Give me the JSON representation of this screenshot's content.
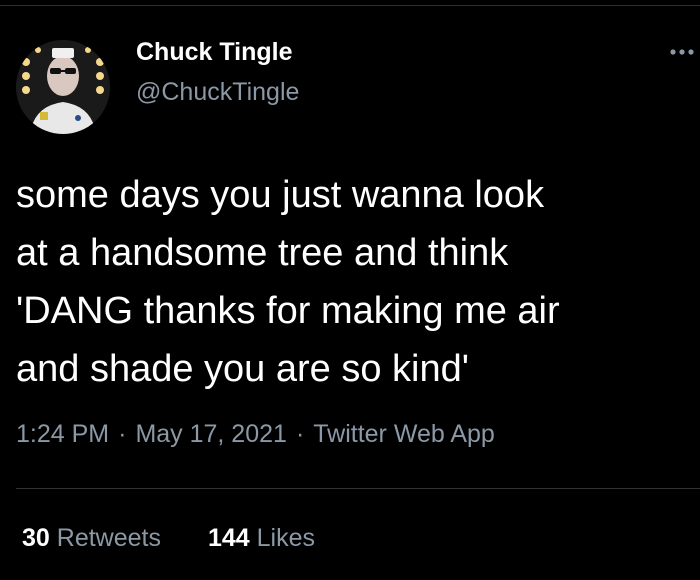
{
  "tweet": {
    "display_name": "Chuck Tingle",
    "handle": "@ChuckTingle",
    "more_icon": "more-horizontal-icon",
    "lines": [
      "some days you just wanna look",
      "at a handsome tree and think",
      "'DANG thanks for making me air",
      "and shade you are so kind'"
    ],
    "time": "1:24 PM",
    "date": "May 17, 2021",
    "source": "Twitter Web App",
    "separator": "·"
  },
  "stats": {
    "retweets_count": "30",
    "retweets_label": "Retweets",
    "likes_count": "144",
    "likes_label": "Likes"
  },
  "colors": {
    "background": "#000000",
    "text_primary": "#ffffff",
    "text_secondary": "#8b98a5",
    "divider": "#2f3336"
  }
}
